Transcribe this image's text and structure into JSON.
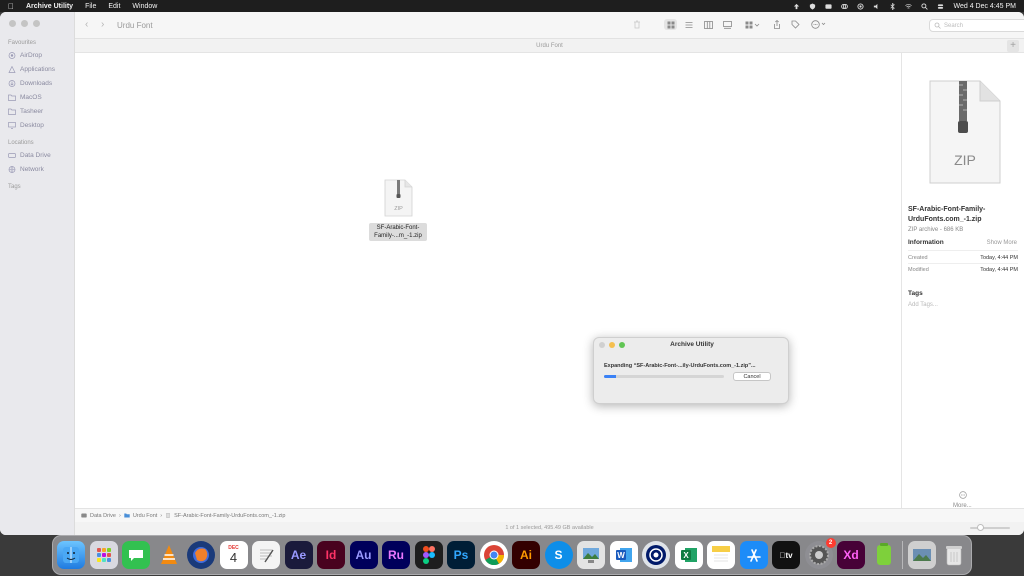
{
  "menubar": {
    "app_name": "Archive Utility",
    "menus": [
      "File",
      "Edit",
      "Window"
    ],
    "datetime": "Wed 4 Dec  4:45 PM"
  },
  "sidebar": {
    "favourites_title": "Favourites",
    "favourites": [
      "AirDrop",
      "Applications",
      "Downloads",
      "MacOS",
      "Tasheer",
      "Desktop"
    ],
    "locations_title": "Locations",
    "locations": [
      "Data Drive",
      "Network"
    ],
    "tags_title": "Tags"
  },
  "toolbar": {
    "title": "Urdu Font",
    "search_placeholder": "Search"
  },
  "tab_title": "Urdu Font",
  "file": {
    "label": "SF-Arabic-Font-Family-...m_-1.zip",
    "icon_text": "ZIP"
  },
  "preview": {
    "icon_text": "ZIP",
    "name": "SF-Arabic-Font-Family-UrduFonts.com_-1.zip",
    "kind": "ZIP archive - 686 KB",
    "info_title": "Information",
    "show_more": "Show More",
    "created_label": "Created",
    "created_value": "Today, 4:44 PM",
    "modified_label": "Modified",
    "modified_value": "Today, 4:44 PM",
    "tags_title": "Tags",
    "add_tags": "Add Tags...",
    "more": "More..."
  },
  "pathbar": {
    "crumbs": [
      "Data Drive",
      "Urdu Font",
      "SF-Arabic-Font-Family-UrduFonts.com_-1.zip"
    ]
  },
  "statusbar": {
    "text": "1 of 1 selected, 495.49 GB available"
  },
  "dialog": {
    "title": "Archive Utility",
    "message": "Expanding “SF-Arabic-Font-...ily-UrduFonts.com_-1.zip”...",
    "progress": 0.1,
    "cancel_label": "Cancel"
  },
  "dock": {
    "calendar_month": "DEC",
    "calendar_day": "4",
    "ae": "Ae",
    "id": "Id",
    "au": "Au",
    "ru": "Ru",
    "ps": "Ps",
    "ai": "Ai",
    "s": "S",
    "xd": "Xd",
    "settings_badge": "2"
  },
  "colors": {
    "accent": "#3b82f6",
    "menubar": "#1e1e1e"
  }
}
